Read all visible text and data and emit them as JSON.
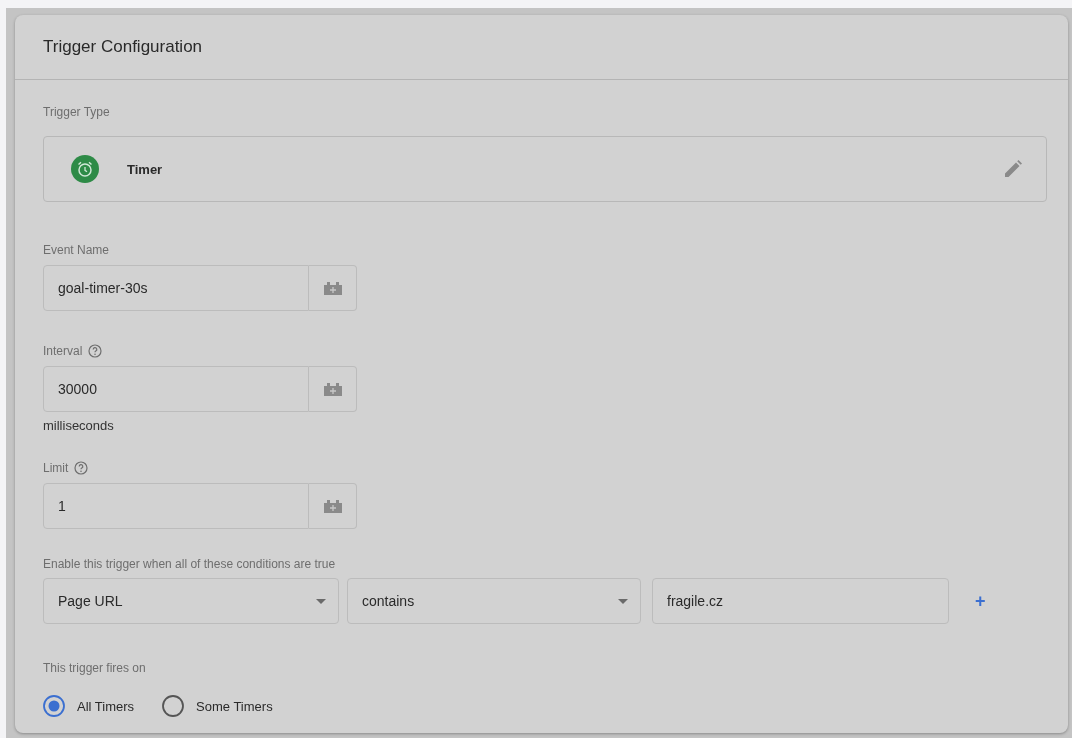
{
  "card": {
    "title": "Trigger Configuration"
  },
  "trigger_type": {
    "label": "Trigger Type",
    "name": "Timer"
  },
  "fields": [
    {
      "label": "Event Name",
      "help": false,
      "value": "goal-timer-30s"
    },
    {
      "label": "Interval",
      "help": true,
      "value": "30000",
      "note": "milliseconds"
    },
    {
      "label": "Limit",
      "help": true,
      "value": "1"
    }
  ],
  "conditions": {
    "label": "Enable this trigger when all of these conditions are true",
    "variable": "Page URL",
    "operator": "contains",
    "value": "fragile.cz",
    "add": "+"
  },
  "fires_on": {
    "label": "This trigger fires on",
    "options": [
      {
        "label": "All Timers",
        "selected": true
      },
      {
        "label": "Some Timers",
        "selected": false
      }
    ]
  }
}
